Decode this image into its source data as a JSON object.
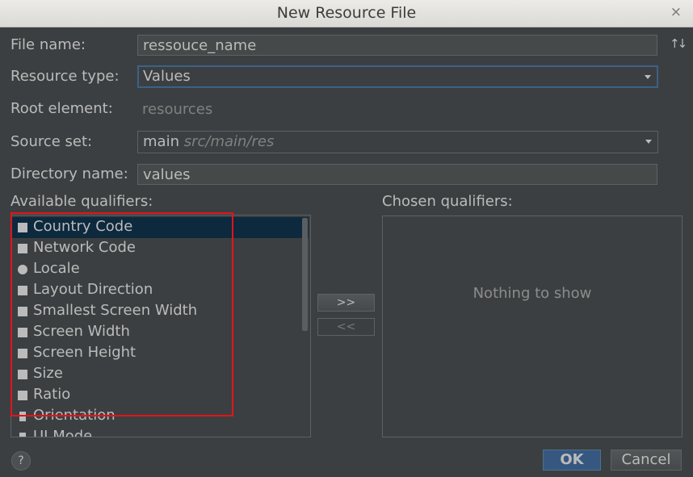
{
  "window": {
    "title": "New Resource File",
    "close_glyph": "×"
  },
  "form": {
    "file_name_label": "File name:",
    "file_name_value": "ressouce_name",
    "sort_glyph": "↑↓",
    "resource_type_label": "Resource type:",
    "resource_type_value": "Values",
    "root_element_label": "Root element:",
    "root_element_value": "resources",
    "source_set_label": "Source set:",
    "source_set_value": "main",
    "source_set_path": "src/main/res",
    "directory_name_label": "Directory name:",
    "directory_name_value": "values"
  },
  "qualifiers": {
    "available_label": "Available qualifiers:",
    "chosen_label": "Chosen qualifiers:",
    "chosen_empty_text": "Nothing to show",
    "add_button": ">>",
    "remove_button": "<<",
    "items": [
      {
        "label": "Country Code",
        "icon": "country-code-icon",
        "selected": true
      },
      {
        "label": "Network Code",
        "icon": "network-code-icon"
      },
      {
        "label": "Locale",
        "icon": "globe-icon"
      },
      {
        "label": "Layout Direction",
        "icon": "layout-direction-icon"
      },
      {
        "label": "Smallest Screen Width",
        "icon": "smallest-width-icon"
      },
      {
        "label": "Screen Width",
        "icon": "screen-width-icon"
      },
      {
        "label": "Screen Height",
        "icon": "screen-height-icon"
      },
      {
        "label": "Size",
        "icon": "size-icon"
      },
      {
        "label": "Ratio",
        "icon": "ratio-icon"
      },
      {
        "label": "Orientation",
        "icon": "orientation-icon"
      },
      {
        "label": "UI Mode",
        "icon": "ui-mode-icon"
      }
    ]
  },
  "footer": {
    "help_glyph": "?",
    "ok_label": "OK",
    "cancel_label": "Cancel"
  },
  "colors": {
    "highlight_box": "#e3141b",
    "selection": "#0d293e",
    "ok_button": "#365880"
  }
}
